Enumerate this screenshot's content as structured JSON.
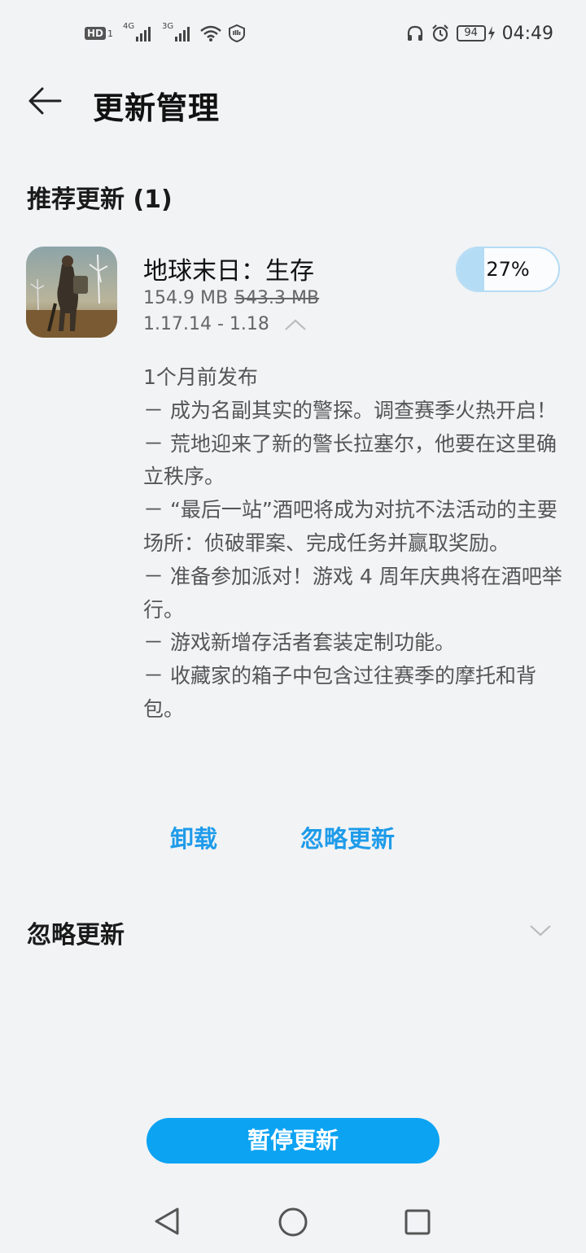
{
  "status_bar": {
    "hd": "HD",
    "sim1": "1",
    "net1": "4G",
    "net2": "3G",
    "battery": "94",
    "time": "04:49"
  },
  "header": {
    "title": "更新管理"
  },
  "recommended": {
    "title": "推荐更新 (1)",
    "app": {
      "name": "地球末日：生存",
      "download_size": "154.9 MB",
      "full_size": "543.3 MB",
      "version": "1.17.14 - 1.18",
      "progress_percent": 27,
      "progress_label": "27%",
      "notes": [
        "1个月前发布",
        "－ 成为名副其实的警探。调查赛季火热开启！",
        "－ 荒地迎来了新的警长拉塞尔，他要在这里确立秩序。",
        "－ “最后一站”酒吧将成为对抗不法活动的主要场所：侦破罪案、完成任务并赢取奖励。",
        "－ 准备参加派对！游戏 4 周年庆典将在酒吧举行。",
        "－ 游戏新增存活者套装定制功能。",
        "－ 收藏家的箱子中包含过往赛季的摩托和背包。"
      ],
      "uninstall_label": "卸载",
      "ignore_label": "忽略更新"
    }
  },
  "ignored": {
    "title": "忽略更新"
  },
  "pause_button": "暂停更新",
  "colors": {
    "accent": "#0ca3f2",
    "link": "#1e9be9",
    "progress": "#b5dcf5"
  },
  "icons": [
    "back-arrow-icon",
    "chevron-up-icon",
    "chevron-down-icon",
    "nav-back-icon",
    "nav-home-icon",
    "nav-recents-icon"
  ]
}
